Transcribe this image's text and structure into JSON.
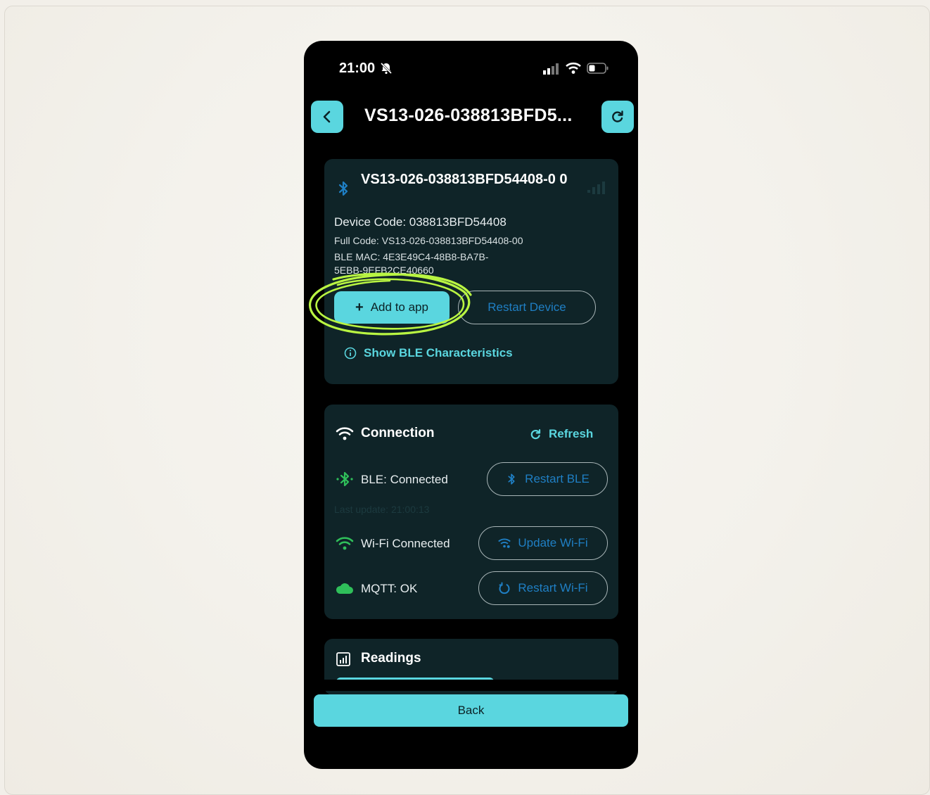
{
  "status_bar": {
    "time": "21:00"
  },
  "header": {
    "title": "VS13-026-038813BFD5..."
  },
  "device_card": {
    "name": "VS13-026-038813BFD54408-0 0",
    "device_code": "Device Code: 038813BFD54408",
    "full_code": "Full Code: VS13-026-038813BFD54408-00",
    "ble_mac": "BLE MAC: 4E3E49C4-48B8-BA7B-5EBB-9EFB2CE40660",
    "add_to_app": "Add to app",
    "restart_device": "Restart Device",
    "show_ble": "Show BLE Characteristics"
  },
  "connection": {
    "title": "Connection",
    "refresh": "Refresh",
    "ble_status": "BLE: Connected",
    "last_update": "Last update: 21:00:13",
    "restart_ble": "Restart BLE",
    "wifi_status": "Wi-Fi Connected",
    "update_wifi": "Update Wi-Fi",
    "mqtt_status": "MQTT: OK",
    "restart_wifi": "Restart Wi-Fi"
  },
  "readings": {
    "title": "Readings"
  },
  "footer": {
    "back": "Back"
  },
  "colors": {
    "accent": "#5ad6df",
    "card": "#0f2428",
    "link_blue": "#1f7fc4",
    "status_green": "#2fbf5a",
    "highlight": "#b9f542"
  }
}
